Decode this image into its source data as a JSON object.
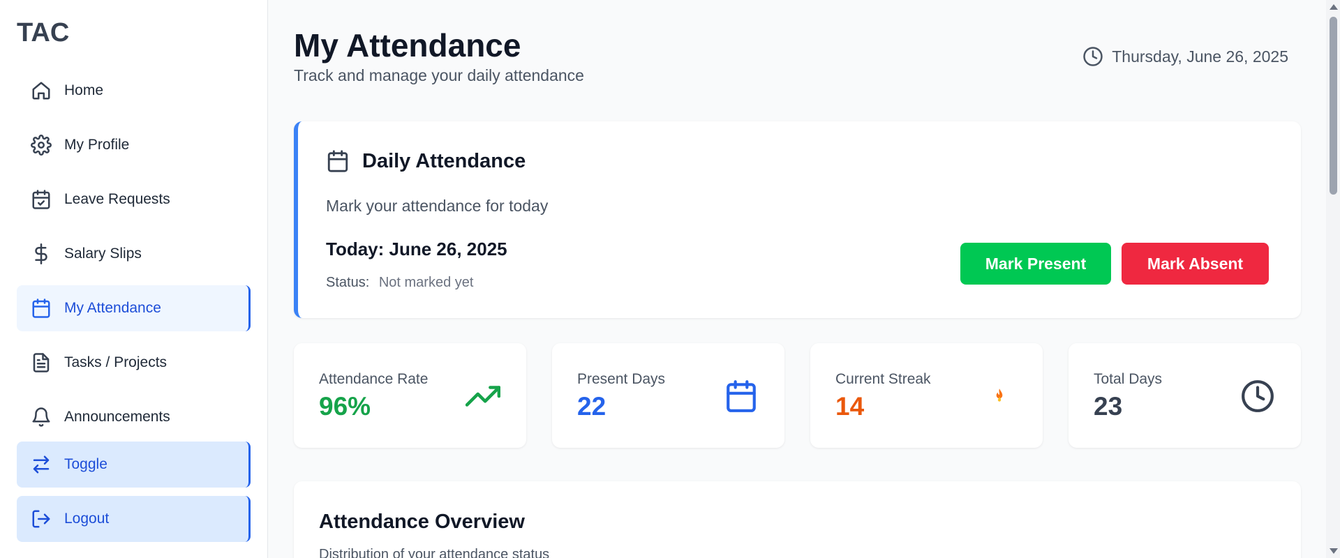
{
  "sidebar": {
    "brand": "TAC",
    "items": [
      {
        "label": "Home",
        "icon": "home-icon"
      },
      {
        "label": "My Profile",
        "icon": "gear-icon"
      },
      {
        "label": "Leave Requests",
        "icon": "calendar-check-icon"
      },
      {
        "label": "Salary Slips",
        "icon": "dollar-icon"
      },
      {
        "label": "My Attendance",
        "icon": "calendar-icon",
        "active": true
      },
      {
        "label": "Tasks / Projects",
        "icon": "document-icon"
      },
      {
        "label": "Announcements",
        "icon": "bell-icon"
      },
      {
        "label": "Toggle",
        "icon": "arrows-swap-icon"
      },
      {
        "label": "Logout",
        "icon": "logout-icon"
      }
    ]
  },
  "header": {
    "title": "My Attendance",
    "subtitle": "Track and manage your daily attendance",
    "date": "Thursday, June 26, 2025",
    "date_icon": "clock-icon"
  },
  "daily": {
    "title": "Daily Attendance",
    "description": "Mark your attendance for today",
    "today": "Today: June 26, 2025",
    "status_label": "Status:",
    "status_value": "Not marked yet",
    "present_button": "Mark Present",
    "absent_button": "Mark Absent"
  },
  "stats": [
    {
      "label": "Attendance Rate",
      "value": "96%",
      "color": "#16a34a",
      "icon": "trending-up-icon"
    },
    {
      "label": "Present Days",
      "value": "22",
      "color": "#2563eb",
      "icon": "calendar-icon"
    },
    {
      "label": "Current Streak",
      "value": "14",
      "color": "#ea580c",
      "icon": "fire-icon"
    },
    {
      "label": "Total Days",
      "value": "23",
      "color": "#374151",
      "icon": "clock-icon"
    }
  ],
  "overview": {
    "title": "Attendance Overview",
    "subtitle": "Distribution of your attendance status"
  },
  "colors": {
    "accent": "#2563eb",
    "present": "#00c853",
    "absent": "#ef2840"
  }
}
